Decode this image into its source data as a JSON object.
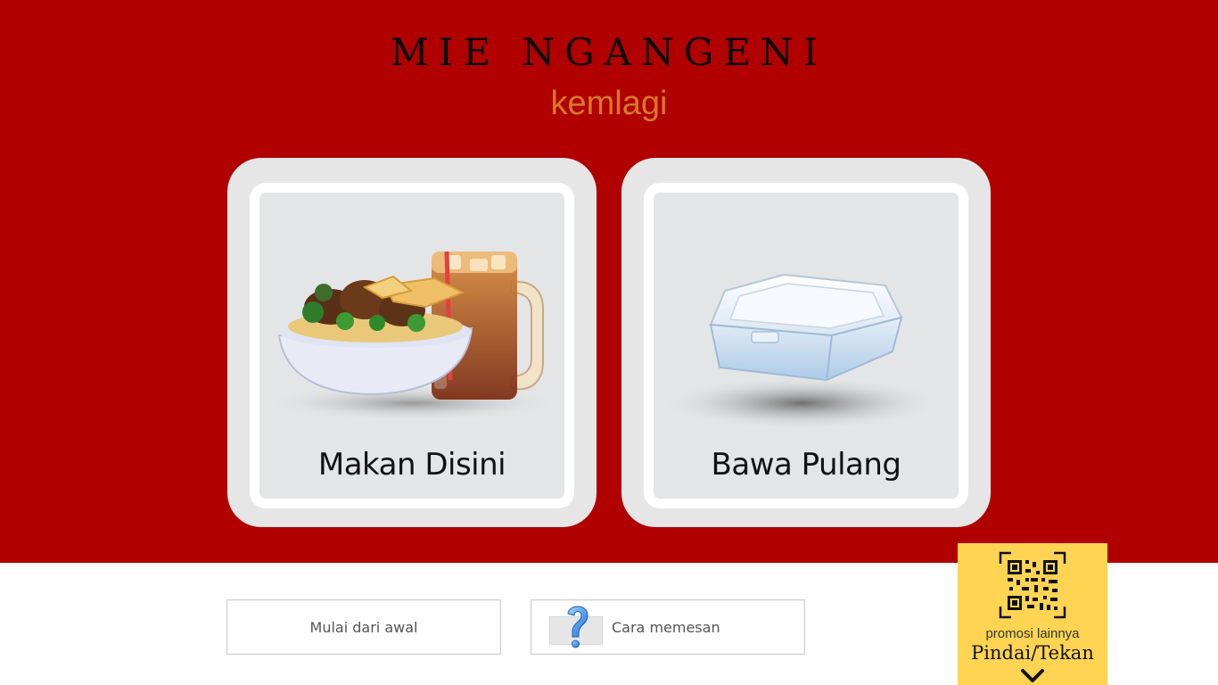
{
  "brand": {
    "title": "MIE NGANGENI",
    "subtitle": "kemlagi"
  },
  "options": [
    {
      "label": "Makan Disini",
      "icon": "noodle-bowl-and-iced-tea"
    },
    {
      "label": "Bawa Pulang",
      "icon": "takeaway-foam-box"
    }
  ],
  "footer": {
    "restart_label": "Mulai dari awal",
    "howto_label": "Cara memesan",
    "howto_icon": "question-mark-icon"
  },
  "promo": {
    "caption": "promosi lainnya",
    "action": "Pindai/Tekan",
    "icon": "qr-code-icon"
  },
  "colors": {
    "hero_background": "#b00000",
    "subtitle": "#d8782a",
    "promo_background": "#ffd452"
  }
}
